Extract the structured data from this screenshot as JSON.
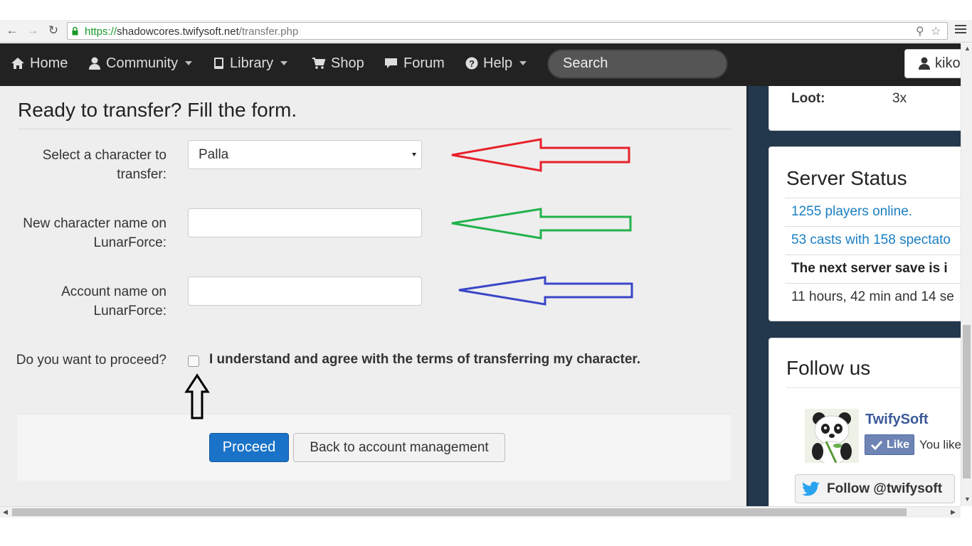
{
  "browser": {
    "url_scheme": "https://",
    "url_host": "shadowcores.twifysoft.net",
    "url_path": "/transfer.php"
  },
  "navbar": {
    "items": [
      {
        "label": "Home",
        "icon": "home-icon"
      },
      {
        "label": "Community",
        "icon": "user-icon"
      },
      {
        "label": "Library",
        "icon": "book-icon"
      },
      {
        "label": "Shop",
        "icon": "cart-icon"
      },
      {
        "label": "Forum",
        "icon": "comment-icon"
      },
      {
        "label": "Help",
        "icon": "question-icon"
      }
    ],
    "search_placeholder": "Search",
    "user_label": "kiko"
  },
  "form": {
    "title": "Ready to transfer? Fill the form.",
    "character_label": "Select a character to transfer:",
    "character_value": "Palla",
    "new_name_label": "New character name on LunarForce:",
    "new_name_value": "",
    "account_label": "Account name on LunarForce:",
    "account_value": "",
    "proceed_label": "Do you want to proceed?",
    "agree_text": "I understand and agree with the terms of transferring my character.",
    "agree_checked": false,
    "proceed_button": "Proceed",
    "back_button": "Back to account management"
  },
  "annotations": {
    "arrow_colors": [
      "#e8202a",
      "#22b24c",
      "#3a46c8",
      "#000000"
    ]
  },
  "sidebar": {
    "loot_label": "Loot:",
    "loot_value": "3x",
    "server_status_title": "Server Status",
    "players_online": "1255 players online.",
    "casts": "53 casts with 158 spectato",
    "next_save": "The next server save is i",
    "next_save_time": "11 hours, 42 min and 14 se",
    "follow_title": "Follow us",
    "fb_name": "TwifySoft",
    "fb_like": "Like",
    "fb_you_like": "You like",
    "twitter_follow": "Follow @twifysoft"
  },
  "colors": {
    "navbar_bg": "#222222",
    "primary_button": "#1a73c8",
    "link": "#1a7fc2",
    "sidebar_bg": "#23384d"
  }
}
